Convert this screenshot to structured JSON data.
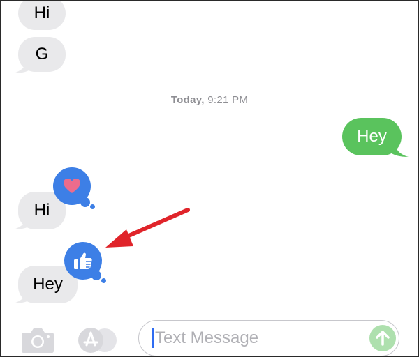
{
  "messages": [
    {
      "id": "m1",
      "direction": "incoming",
      "text": "Hi"
    },
    {
      "id": "m2",
      "direction": "incoming",
      "text": "G"
    },
    {
      "id": "m3",
      "direction": "outgoing",
      "text": "Hey"
    },
    {
      "id": "m4",
      "direction": "incoming",
      "text": "Hi",
      "tapback": "heart"
    },
    {
      "id": "m5",
      "direction": "incoming",
      "text": "Hey",
      "tapback": "thumbs-up"
    }
  ],
  "timestamp": {
    "day": "Today,",
    "time": "9:21 PM"
  },
  "composer": {
    "placeholder": "Text Message",
    "camera_icon": "camera-icon",
    "apps_icon": "app-store-icon",
    "send_icon": "send-arrow-icon"
  },
  "colors": {
    "incoming_bubble": "#e9e9eb",
    "outgoing_bubble": "#5ac35d",
    "tapback_blue": "#3d7fe6",
    "heart": "#ec6c8c",
    "annotation_arrow": "#e0242a",
    "send_button": "#aee0ae"
  },
  "annotation": {
    "type": "arrow",
    "points_to": "thumbs-up-tapback"
  }
}
